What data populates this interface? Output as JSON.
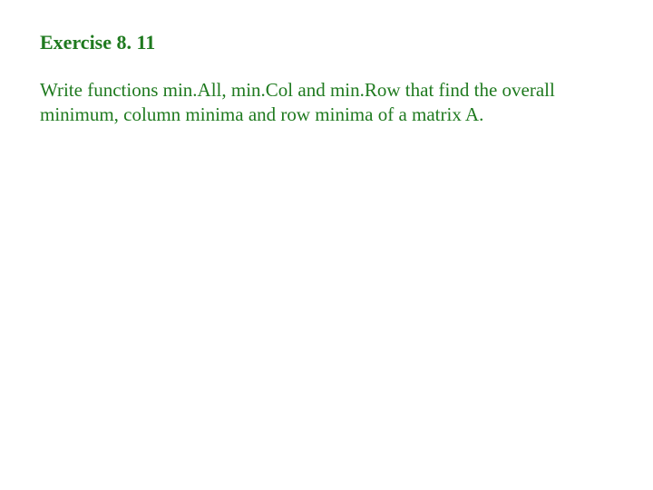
{
  "slide": {
    "title": "Exercise 8. 11",
    "body": "Write functions min.All, min.Col and min.Row that find the overall minimum, column minima and row minima of a matrix A."
  }
}
